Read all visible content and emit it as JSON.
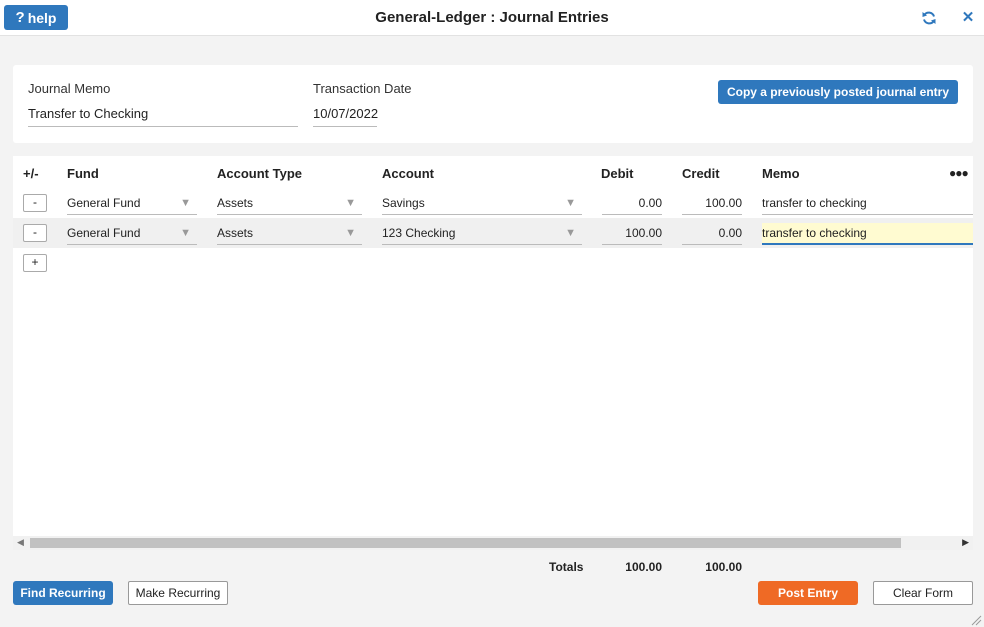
{
  "titlebar": {
    "help_label": "help",
    "title": "General-Ledger : Journal Entries"
  },
  "header": {
    "memo_label": "Journal Memo",
    "memo_value": "Transfer to Checking",
    "date_label": "Transaction Date",
    "date_value": "10/07/2022",
    "copy_label": "Copy a previously posted journal entry"
  },
  "grid": {
    "columns": {
      "plusminus": "+/-",
      "fund": "Fund",
      "account_type": "Account Type",
      "account": "Account",
      "debit": "Debit",
      "credit": "Credit",
      "memo": "Memo"
    },
    "rows": [
      {
        "remove": "-",
        "fund": "General Fund",
        "account_type": "Assets",
        "account": "Savings",
        "debit": "0.00",
        "credit": "100.00",
        "memo": "transfer to checking"
      },
      {
        "remove": "-",
        "fund": "General Fund",
        "account_type": "Assets",
        "account": "123 Checking",
        "debit": "100.00",
        "credit": "0.00",
        "memo": "transfer to checking"
      }
    ],
    "add_label": "+"
  },
  "totals": {
    "label": "Totals",
    "debit": "100.00",
    "credit": "100.00"
  },
  "footer": {
    "find_recurring": "Find Recurring",
    "make_recurring": "Make Recurring",
    "post_entry": "Post Entry",
    "clear_form": "Clear Form"
  },
  "colors": {
    "primary": "#2f78bd",
    "accent": "#ef6a25",
    "active_cell": "#fffbd1"
  }
}
